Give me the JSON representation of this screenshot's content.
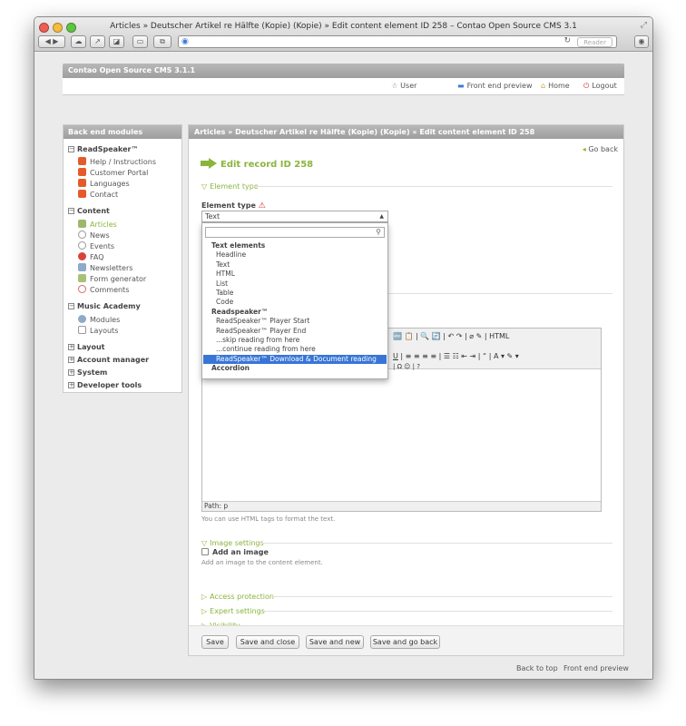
{
  "window": {
    "title": "Articles » Deutscher Artikel re Hälfte (Kopie) (Kopie) » Edit content element ID 258 – Contao Open Source CMS 3.1",
    "reader_label": "Reader"
  },
  "colors": {
    "accent_green": "#8ab53b",
    "selection_blue": "#3875d7",
    "header_gray": "#a8a8a8"
  },
  "header": {
    "app_title": "Contao Open Source CMS 3.1.1",
    "nav": {
      "user": "User",
      "frontend_preview": "Front end preview",
      "home": "Home",
      "logout": "Logout"
    }
  },
  "sidebar": {
    "title": "Back end modules",
    "groups": [
      {
        "label": "ReadSpeaker™",
        "toggle": "−",
        "items": [
          "Help / Instructions",
          "Customer Portal",
          "Languages",
          "Contact"
        ]
      },
      {
        "label": "Content",
        "toggle": "−",
        "items": [
          "Articles",
          "News",
          "Events",
          "FAQ",
          "Newsletters",
          "Form generator",
          "Comments"
        ]
      },
      {
        "label": "Music Academy",
        "toggle": "−",
        "items": [
          "Modules",
          "Layouts"
        ]
      },
      {
        "label": "Layout",
        "toggle": "+"
      },
      {
        "label": "Account manager",
        "toggle": "+"
      },
      {
        "label": "System",
        "toggle": "+"
      },
      {
        "label": "Developer tools",
        "toggle": "+"
      }
    ]
  },
  "main": {
    "breadcrumb": "Articles » Deutscher Artikel re Hälfte (Kopie) (Kopie) » Edit content element ID 258",
    "go_back": "Go back",
    "edit_title": "Edit record ID 258",
    "legend_element_type": "Element type",
    "element_type_label": "Element type",
    "element_type_value": "Text",
    "dropdown": {
      "options": [
        {
          "text": "Text elements",
          "kind": "header"
        },
        {
          "text": "Headline",
          "kind": "option"
        },
        {
          "text": "Text",
          "kind": "option"
        },
        {
          "text": "HTML",
          "kind": "option"
        },
        {
          "text": "List",
          "kind": "option"
        },
        {
          "text": "Table",
          "kind": "option"
        },
        {
          "text": "Code",
          "kind": "option"
        },
        {
          "text": "Readspeaker™",
          "kind": "header"
        },
        {
          "text": "ReadSpeaker™ Player Start",
          "kind": "option"
        },
        {
          "text": "ReadSpeaker™ Player End",
          "kind": "option"
        },
        {
          "text": "...skip reading from here",
          "kind": "option"
        },
        {
          "text": "...continue reading from here",
          "kind": "option"
        },
        {
          "text": "ReadSpeaker™ Download & Document reading",
          "kind": "selected"
        },
        {
          "text": "Accordion",
          "kind": "header"
        }
      ]
    },
    "editor_path": "Path: p",
    "html_hint": "You can use HTML tags to format the text.",
    "legend_image": "Image settings",
    "add_image_label": "Add an image",
    "add_image_hint": "Add an image to the content element.",
    "legend_access": "Access protection",
    "legend_expert": "Expert settings",
    "legend_visibility": "Visibility",
    "buttons": {
      "save": "Save",
      "save_close": "Save and close",
      "save_new": "Save and new",
      "save_back": "Save and go back"
    }
  },
  "footer_links": {
    "back_to_top": "Back to top",
    "frontend_preview": "Front end preview"
  }
}
